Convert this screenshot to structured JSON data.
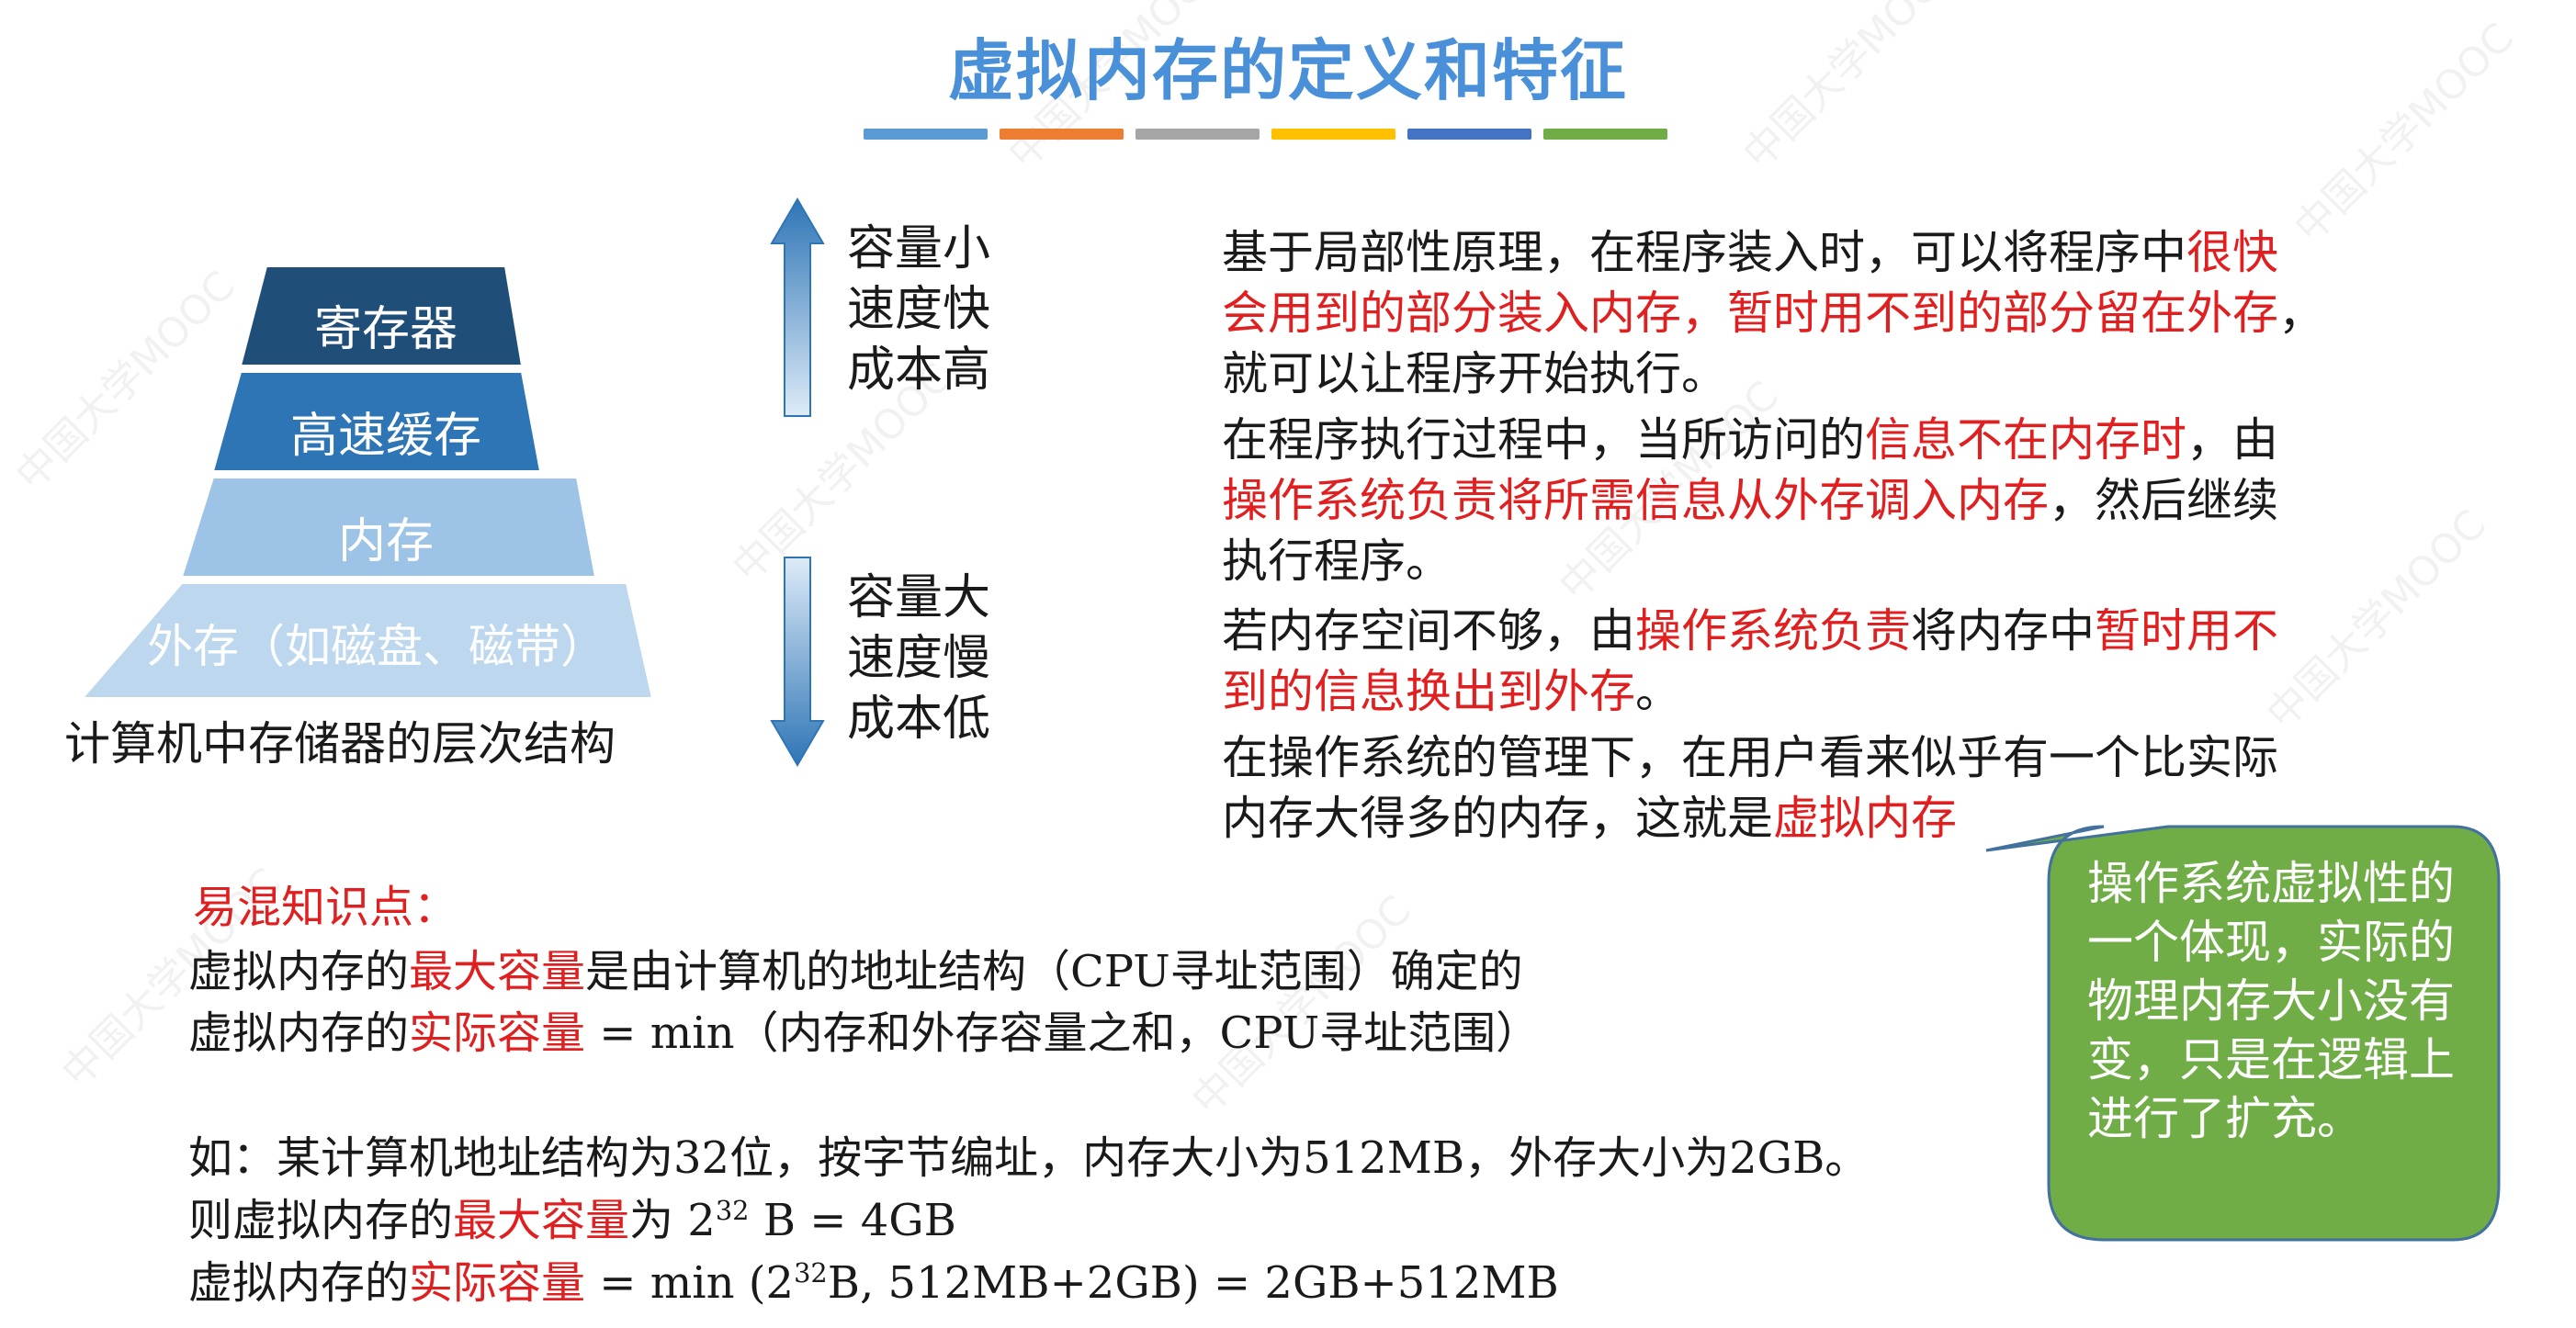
{
  "watermark": {
    "text": "中国大学MOOC"
  },
  "title": "虚拟内存的定义和特征",
  "title_bar_colors": [
    "#5b9bd5",
    "#ed7d31",
    "#a5a5a5",
    "#ffc000",
    "#4472c4",
    "#70ad47"
  ],
  "pyramid": {
    "levels": [
      "寄存器",
      "高速缓存",
      "内存",
      "外存（如磁盘、磁带）"
    ],
    "colors": [
      "#1f4e79",
      "#2e75b6",
      "#9dc3e6",
      "#bdd7ee"
    ],
    "caption": "计算机中存储器的层次结构"
  },
  "up_text": [
    "容量小",
    "速度快",
    "成本高"
  ],
  "down_text": [
    "容量大",
    "速度慢",
    "成本低"
  ],
  "paragraphs": [
    {
      "lines": [
        [
          {
            "t": "基于局部性原理，在程序装入时，可以将程序中"
          },
          {
            "t": "很快",
            "red": true
          }
        ],
        [
          {
            "t": "会用到的部分装入内存，暂时用不到的部分留在外存",
            "red": true
          },
          {
            "t": "，"
          }
        ],
        [
          {
            "t": "就可以让程序开始执行。"
          }
        ]
      ]
    },
    {
      "lines": [
        [
          {
            "t": "在程序执行过程中，当所访问的"
          },
          {
            "t": "信息不在内存时",
            "red": true
          },
          {
            "t": "，由"
          }
        ],
        [
          {
            "t": "操作系统负责将所需信息从外存调入内存",
            "red": true
          },
          {
            "t": "，然后继续"
          }
        ],
        [
          {
            "t": "执行程序。"
          }
        ]
      ]
    },
    {
      "lines": [
        [
          {
            "t": "若内存空间不够，由"
          },
          {
            "t": "操作系统负责",
            "red": true
          },
          {
            "t": "将内存中"
          },
          {
            "t": "暂时用不",
            "red": true
          }
        ],
        [
          {
            "t": "到的信息换出到外存",
            "red": true
          },
          {
            "t": "。"
          }
        ]
      ]
    },
    {
      "lines": [
        [
          {
            "t": "在操作系统的管理下，在用户看来似乎有一个比实际"
          }
        ],
        [
          {
            "t": "内存大得多的内存，这就是"
          },
          {
            "t": "虚拟内存",
            "red": true
          }
        ]
      ]
    }
  ],
  "notes": {
    "heading": "易混知识点：",
    "line1": [
      {
        "t": "虚拟内存的"
      },
      {
        "t": "最大容量",
        "red": true
      },
      {
        "t": "是由计算机的地址结构（CPU寻址范围）确定的"
      }
    ],
    "line2": [
      {
        "t": "虚拟内存的"
      },
      {
        "t": "实际容量",
        "red": true
      },
      {
        "t": " = min（内存和外存容量之和，CPU寻址范围）"
      }
    ],
    "example": [
      {
        "t": "如：某计算机地址结构为32位，按字节编址，内存大小为512MB，外存大小为2GB。"
      }
    ],
    "ex1": [
      {
        "t": "则虚拟内存的"
      },
      {
        "t": "最大容量",
        "red": true
      },
      {
        "t": "为 2"
      },
      {
        "t": "32",
        "sup": true
      },
      {
        "t": " B = 4GB"
      }
    ],
    "ex2": [
      {
        "t": "虚拟内存的"
      },
      {
        "t": "实际容量",
        "red": true
      },
      {
        "t": " = min (2"
      },
      {
        "t": "32",
        "sup": true
      },
      {
        "t": "B, 512MB+2GB) = 2GB+512MB"
      }
    ]
  },
  "callout": {
    "text": "操作系统虚拟性的一个体现，实际的物理内存大小没有变，只是在逻辑上进行了扩充。",
    "color": "#70ad47"
  }
}
